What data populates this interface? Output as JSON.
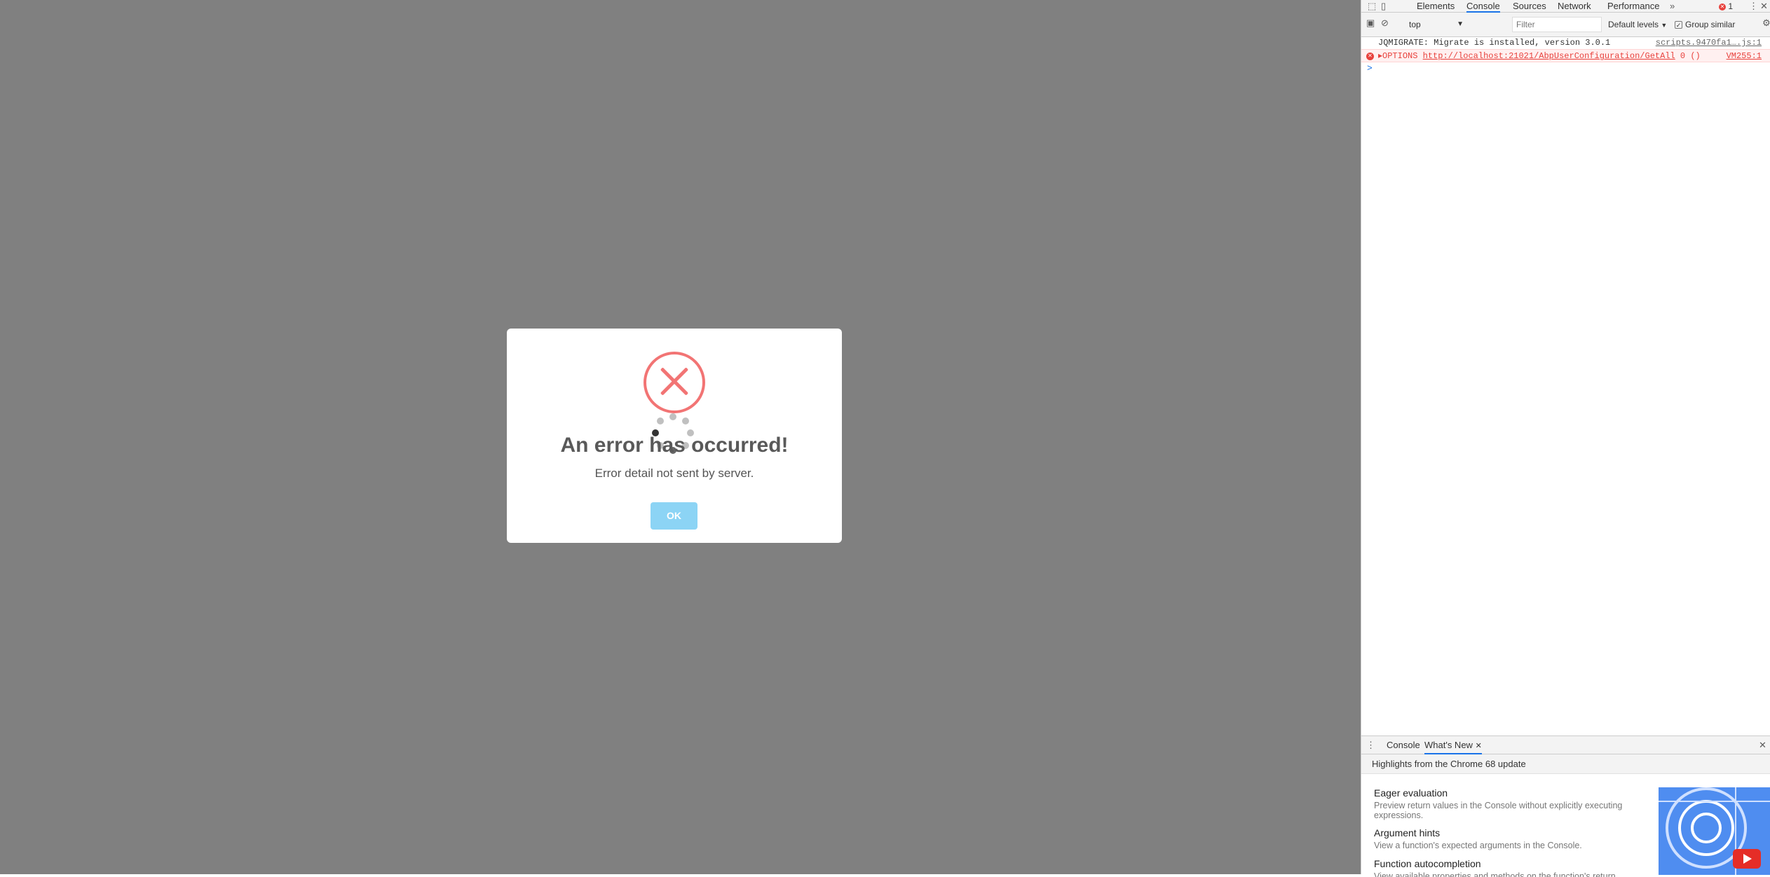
{
  "modal": {
    "title": "An error has occurred!",
    "message": "Error detail not sent by server.",
    "ok_label": "OK"
  },
  "devtools": {
    "tabs": [
      "Elements",
      "Console",
      "Sources",
      "Network",
      "Performance"
    ],
    "active_tab": "Console",
    "more_tabs": "»",
    "error_count": "1",
    "context": "top",
    "filter_placeholder": "Filter",
    "levels": "Default levels",
    "group_similar": "Group similar",
    "logs": [
      {
        "text": "JQMIGRATE: Migrate is installed, version 3.0.1",
        "source": "scripts.9470fa1….js:1"
      },
      {
        "method": "OPTIONS",
        "url": "http://localhost:21021/AbpUserConfiguration/GetAll",
        "suffix": "0 ()",
        "source": "VM255:1"
      }
    ],
    "prompt": ">",
    "drawer": {
      "tabs": [
        "Console",
        "What's New"
      ],
      "active_tab": "What's New",
      "header": "Highlights from the Chrome 68 update",
      "features": [
        {
          "title": "Eager evaluation",
          "desc": "Preview return values in the Console without explicitly executing expressions."
        },
        {
          "title": "Argument hints",
          "desc": "View a function's expected arguments in the Console."
        },
        {
          "title": "Function autocompletion",
          "desc": "View available properties and methods on the function's return value."
        }
      ]
    }
  },
  "colors": {
    "overlay": "#808080",
    "error_red": "#f27474",
    "ok_button": "#8cd4f5",
    "accent_blue": "#1a73e8"
  }
}
